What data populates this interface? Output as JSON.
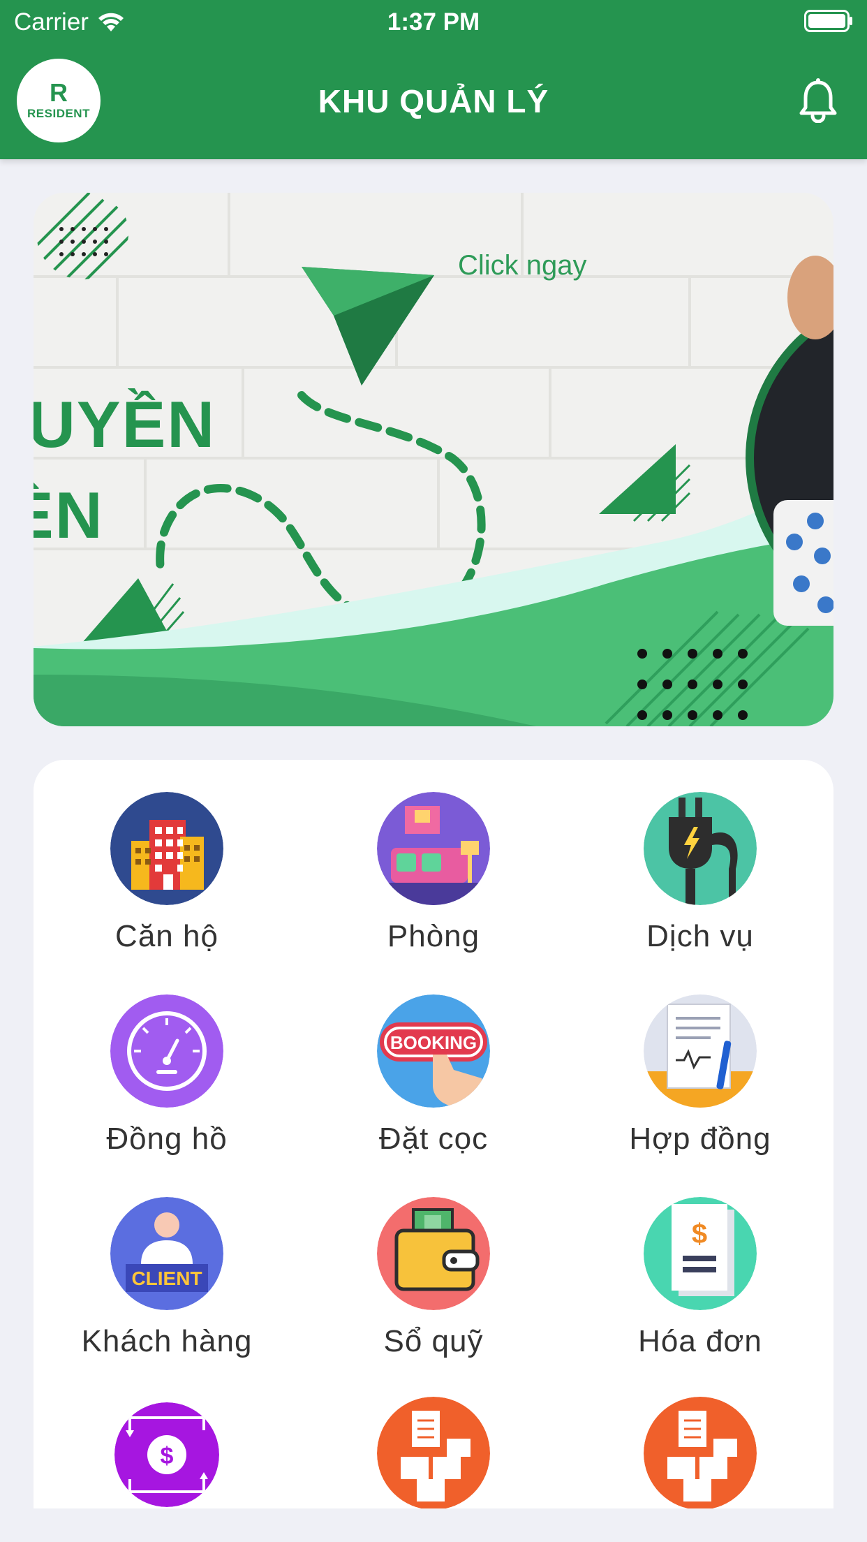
{
  "status_bar": {
    "carrier": "Carrier",
    "time": "1:37 PM"
  },
  "header": {
    "logo_text": "RESIDENT",
    "logo_mark": "R",
    "title": "KHU QUẢN LÝ",
    "notification_icon": "bell-icon"
  },
  "banner": {
    "cta": "Click ngay",
    "headline_line1": "UYỀN",
    "headline_line2": "ÈN"
  },
  "menu": {
    "items": [
      {
        "label": "Căn hộ",
        "icon": "apartment-building-icon",
        "color": "#2f4a8f"
      },
      {
        "label": "Phòng",
        "icon": "room-furniture-icon",
        "color": "#7b5bd6"
      },
      {
        "label": "Dịch vụ",
        "icon": "power-plug-icon",
        "color": "#4cc4a5"
      },
      {
        "label": "Đồng hồ",
        "icon": "meter-gauge-icon",
        "color": "#a15cf0"
      },
      {
        "label": "Đặt cọc",
        "icon": "booking-icon",
        "color": "#4aa3e8"
      },
      {
        "label": "Hợp đồng",
        "icon": "contract-icon",
        "color": "#f5a623"
      },
      {
        "label": "Khách hàng",
        "icon": "client-icon",
        "color": "#5b6ee0"
      },
      {
        "label": "Sổ quỹ",
        "icon": "wallet-icon",
        "color": "#f36d6d"
      },
      {
        "label": "Hóa đơn",
        "icon": "invoice-icon",
        "color": "#49d6b0"
      },
      {
        "label": "",
        "icon": "money-transfer-icon",
        "color": "#a616e0"
      },
      {
        "label": "",
        "icon": "inventory-boxes-icon",
        "color": "#f0602b"
      },
      {
        "label": "",
        "icon": "inventory-boxes-icon",
        "color": "#f0602b"
      }
    ]
  }
}
